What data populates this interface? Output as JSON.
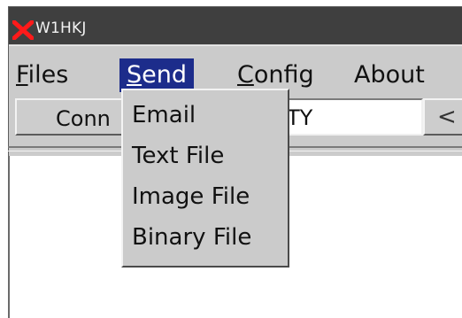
{
  "window": {
    "title": "W1HKJ",
    "icon": "x-icon"
  },
  "menubar": {
    "items": [
      {
        "mnemonic": "F",
        "rest": "iles"
      },
      {
        "mnemonic": "S",
        "rest": "end"
      },
      {
        "mnemonic": "C",
        "rest": "onfig"
      },
      {
        "mnemonic": "",
        "rest": "About"
      }
    ]
  },
  "toolbar": {
    "connect_label": "Conn",
    "mode_value": "TY",
    "arrow_glyph": "<"
  },
  "send_menu": {
    "items": [
      "Email",
      "Text File",
      "Image File",
      "Binary File"
    ]
  },
  "colors": {
    "highlight": "#1c2c8b",
    "title_bg": "#3f3f3f",
    "icon": "#ff1a1a"
  }
}
